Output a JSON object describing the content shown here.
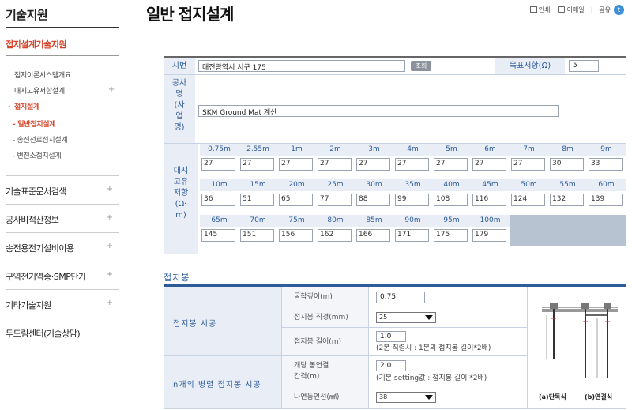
{
  "sidebar": {
    "title": "기술지원",
    "section": "접지설계기술지원",
    "sub_items": [
      {
        "label": "접지이론시스템개요",
        "active": false,
        "has_plus": false
      },
      {
        "label": "대지고유저항설계",
        "active": false,
        "has_plus": true
      },
      {
        "label": "접지설계",
        "active": true,
        "has_plus": false
      }
    ],
    "sub_sub_items": [
      {
        "label": "일반접지설계",
        "active": true
      },
      {
        "label": "송전선로접지설계",
        "active": false
      },
      {
        "label": "변전소접지설계",
        "active": false
      }
    ],
    "main_items": [
      {
        "label": "기술표준문서검색",
        "has_plus": true
      },
      {
        "label": "공사비적산정보",
        "has_plus": true
      },
      {
        "label": "송전용전기설비이용",
        "has_plus": true
      },
      {
        "label": "구역전기역송·SMP단가",
        "has_plus": true
      },
      {
        "label": "기타기술지원",
        "has_plus": true
      },
      {
        "label": "두드림센터(기술상담)",
        "has_plus": false
      }
    ]
  },
  "header": {
    "title": "일반 접지설계",
    "print": "인쇄",
    "email": "이메일",
    "share": "공유",
    "share_glyph": "t"
  },
  "form": {
    "address_label": "지번",
    "address_value": "대전광역시 서구 175",
    "search_button": "조회",
    "target_label": "목표저항(Ω)",
    "target_value": "5",
    "project_label": [
      "공사",
      "명",
      "(사",
      "업",
      "명)"
    ],
    "project_value": "SKM Ground Mat 계산",
    "resistivity_label": [
      "대지",
      "고유",
      "저항",
      "(Ω·",
      "m)"
    ],
    "resistivity_rows": [
      {
        "depths": [
          "0.75m",
          "2.55m",
          "1m",
          "2m",
          "3m",
          "4m",
          "5m",
          "6m",
          "7m",
          "8m",
          "9m"
        ],
        "values": [
          "27",
          "27",
          "27",
          "27",
          "27",
          "27",
          "27",
          "27",
          "27",
          "30",
          "33"
        ]
      },
      {
        "depths": [
          "10m",
          "15m",
          "20m",
          "25m",
          "30m",
          "35m",
          "40m",
          "45m",
          "50m",
          "55m",
          "60m"
        ],
        "values": [
          "36",
          "51",
          "65",
          "77",
          "88",
          "99",
          "108",
          "116",
          "124",
          "132",
          "139"
        ]
      },
      {
        "depths": [
          "65m",
          "70m",
          "75m",
          "80m",
          "85m",
          "90m",
          "95m",
          "100m"
        ],
        "values": [
          "145",
          "151",
          "156",
          "162",
          "166",
          "171",
          "175",
          "179"
        ]
      }
    ]
  },
  "ground_rod": {
    "section_title": "접지봉",
    "group1_label": "접지봉 시공",
    "dig_depth_label": "굴착깊이(m)",
    "dig_depth_value": "0.75",
    "diameter_label": "접지봉 직경(mm)",
    "diameter_value": "25",
    "length_label": "접지봉 길이(m)",
    "length_value": "1.0",
    "length_note": "(2본 직렬시 : 1본의 접지봉 길이*2배)",
    "group2_label": "n개의 병렬 접지봉 시공",
    "spacing_label_1": "개당 봉연결",
    "spacing_label_2": "간격(m)",
    "spacing_value": "2.0",
    "spacing_note": "(기본 setting값 : 접지봉 길이 *2배)",
    "wire_label": "나연동연선(㎟)",
    "wire_value": "38",
    "diagram_caption_a": "(a)단독식",
    "diagram_caption_b": "(b)연결식"
  }
}
